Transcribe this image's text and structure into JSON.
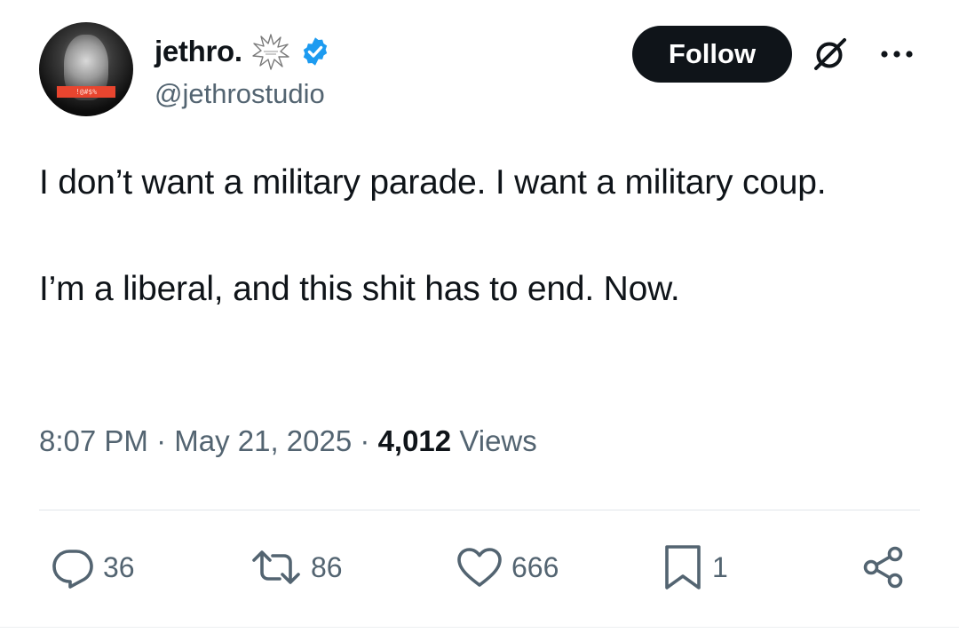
{
  "author": {
    "display_name": "jethro.",
    "handle": "@jethrostudio",
    "avatar_censor_text": "!@#$%",
    "badge_icon": "burst-icon",
    "verified_icon": "verified-badge-icon",
    "verified_color": "#1d9bf0"
  },
  "header": {
    "follow_label": "Follow",
    "grok_icon": "grok-icon",
    "more_icon": "more-options-icon"
  },
  "tweet": {
    "paragraphs": [
      "I don’t want a military parade. I want a military coup.",
      "I’m a liberal, and this shit has to end. Now."
    ],
    "time": "8:07 PM",
    "date": "May 21, 2025",
    "separator": "·",
    "views_count": "4,012",
    "views_label": "Views"
  },
  "actions": {
    "replies": "36",
    "reposts": "86",
    "likes": "666",
    "bookmarks": "1"
  },
  "colors": {
    "text_primary": "#0f1419",
    "text_secondary": "#536471",
    "follow_bg": "#0f1419",
    "divider": "#e1e6ea"
  }
}
